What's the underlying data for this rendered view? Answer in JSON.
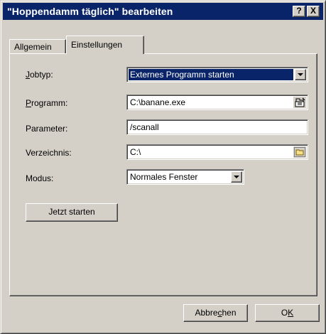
{
  "window": {
    "title": "\"Hoppendamm täglich\" bearbeiten",
    "help_label": "?",
    "close_label": "X"
  },
  "tabs": [
    {
      "label": "Allgemein",
      "active": false
    },
    {
      "label": "Einstellungen",
      "active": true
    }
  ],
  "form": {
    "jobtyp": {
      "label_prefix": "J",
      "label_rest": "obtyp:",
      "value": "Externes Programm starten"
    },
    "programm": {
      "label_prefix": "P",
      "label_rest": "rogramm:",
      "value": "C:\\banane.exe",
      "icon": "open-file-icon"
    },
    "parameter": {
      "label": "Parameter:",
      "value": "/scanall"
    },
    "verzeichnis": {
      "label": "Verzeichnis:",
      "value": "C:\\",
      "icon": "folder-icon"
    },
    "modus": {
      "label": "Modus:",
      "value": "Normales Fenster"
    }
  },
  "buttons": {
    "run_now": "Jetzt starten",
    "cancel_pre": "Abbre",
    "cancel_u": "c",
    "cancel_post": "hen",
    "ok_pre": "O",
    "ok_u": "K"
  },
  "colors": {
    "titlebar": "#0a246a",
    "face": "#d4d0c8",
    "selection": "#0a246a"
  }
}
